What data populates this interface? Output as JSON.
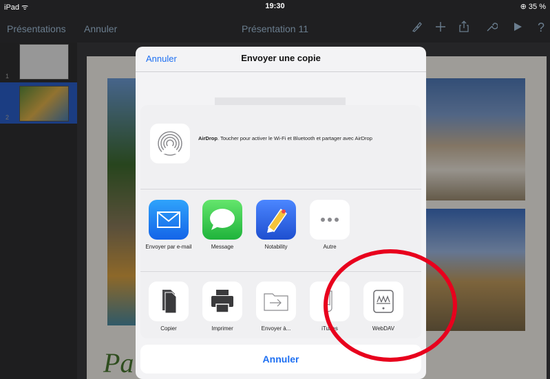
{
  "status_bar": {
    "left": "iPad ᯤ",
    "time": "19:30",
    "battery": "⊕ 35 %"
  },
  "toolbar": {
    "presentations": "Présentations",
    "cancel": "Annuler",
    "doc_title": "Présentation 11",
    "icons": [
      "paint-brush-icon",
      "plus-icon",
      "share-icon",
      "wrench-icon",
      "play-icon",
      "help-icon"
    ],
    "help_glyph": "?"
  },
  "navigator": {
    "thumbs": [
      {
        "num": "1"
      },
      {
        "num": "2"
      }
    ]
  },
  "slide": {
    "title_partial": "Pa"
  },
  "sheet": {
    "cancel": "Annuler",
    "title": "Envoyer une copie"
  },
  "share": {
    "airdrop_bold": "AirDrop",
    "airdrop_text": ". Toucher pour activer le Wi-Fi et Bluetooth et partager avec AirDrop",
    "apps": [
      {
        "label": "Envoyer par e-mail",
        "icon": "mail-icon",
        "color": "#1e8cf3"
      },
      {
        "label": "Message",
        "icon": "message-icon",
        "color": "#3fcc4a"
      },
      {
        "label": "Notability",
        "icon": "notability-icon",
        "color": "#2d62e3"
      },
      {
        "label": "Autre",
        "icon": "more-icon",
        "color": "#ffffff"
      }
    ],
    "actions": [
      {
        "label": "Copier",
        "icon": "copy-icon"
      },
      {
        "label": "Imprimer",
        "icon": "print-icon"
      },
      {
        "label": "Envoyer à...",
        "icon": "send-to-folder-icon"
      },
      {
        "label": "iTunes",
        "icon": "itunes-icon"
      },
      {
        "label": "WebDAV",
        "icon": "webdav-icon"
      }
    ],
    "cancel": "Annuler"
  },
  "colors": {
    "accent": "#1d6ff2",
    "highlight": "#e8001d"
  }
}
